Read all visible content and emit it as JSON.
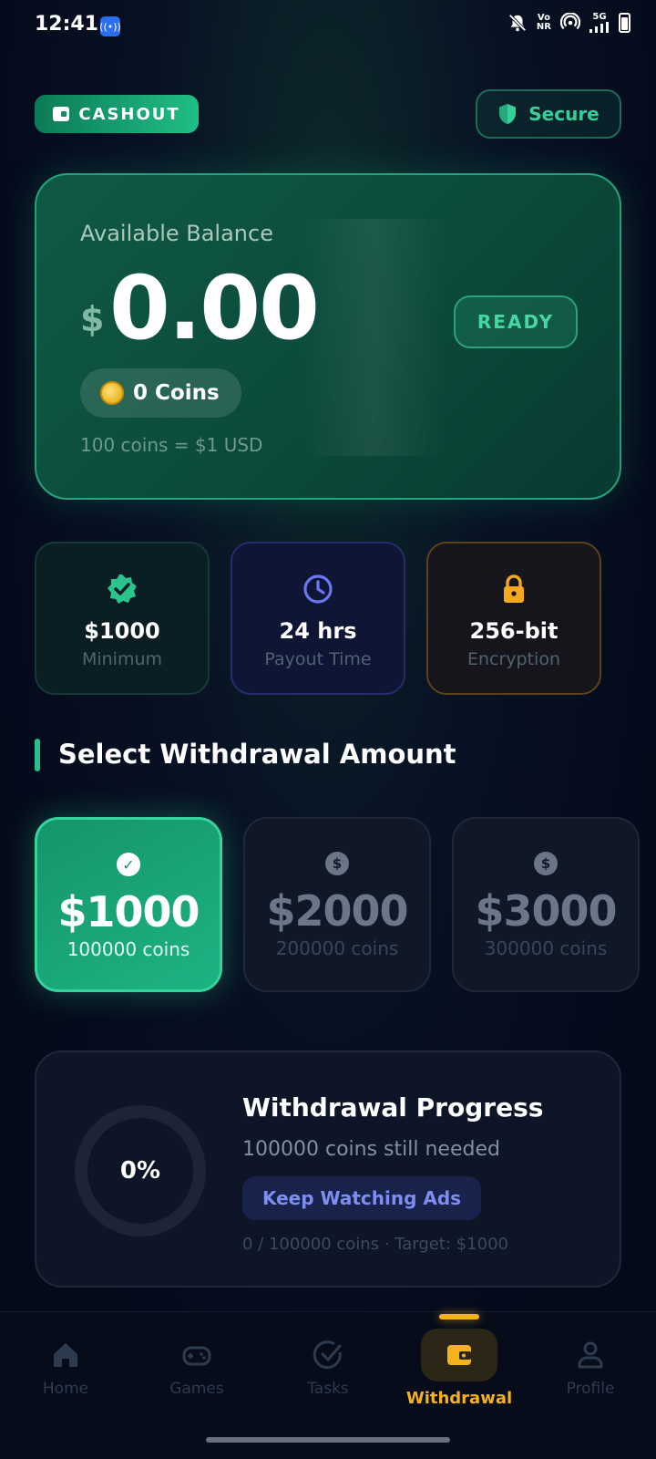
{
  "status_bar": {
    "time": "12:41",
    "network_top": "Vo",
    "network_bottom": "NR",
    "signal": "5G"
  },
  "header": {
    "cashout_label": "CASHOUT",
    "secure_label": "Secure"
  },
  "balance": {
    "label": "Available Balance",
    "currency_symbol": "$",
    "amount": "0.00",
    "coins": "0 Coins",
    "rate": "100 coins = $1 USD",
    "status": "READY"
  },
  "info_cards": [
    {
      "icon": "verified-badge-icon",
      "value": "$1000",
      "label": "Minimum"
    },
    {
      "icon": "clock-icon",
      "value": "24 hrs",
      "label": "Payout Time"
    },
    {
      "icon": "lock-icon",
      "value": "256-bit",
      "label": "Encryption"
    }
  ],
  "section": {
    "title": "Select Withdrawal Amount"
  },
  "amounts": [
    {
      "value": "$1000",
      "coins": "100000 coins",
      "selected": true
    },
    {
      "value": "$2000",
      "coins": "200000 coins",
      "selected": false
    },
    {
      "value": "$3000",
      "coins": "300000 coins",
      "selected": false
    }
  ],
  "progress": {
    "percent_text": "0%",
    "percent_value": 0,
    "title": "Withdrawal Progress",
    "subtitle": "100000 coins still needed",
    "button_label": "Keep Watching Ads",
    "footer": "0 / 100000 coins  ·  Target: $1000"
  },
  "nav": {
    "items": [
      {
        "label": "Home",
        "icon": "home-icon"
      },
      {
        "label": "Games",
        "icon": "gamepad-icon"
      },
      {
        "label": "Tasks",
        "icon": "check-circle-icon"
      },
      {
        "label": "Withdrawal",
        "icon": "wallet-icon",
        "active": true
      },
      {
        "label": "Profile",
        "icon": "person-icon"
      }
    ]
  },
  "colors": {
    "accent_green": "#25c18a",
    "accent_gold": "#f5b21a",
    "accent_indigo": "#7f8df0",
    "background": "#050b1c"
  }
}
